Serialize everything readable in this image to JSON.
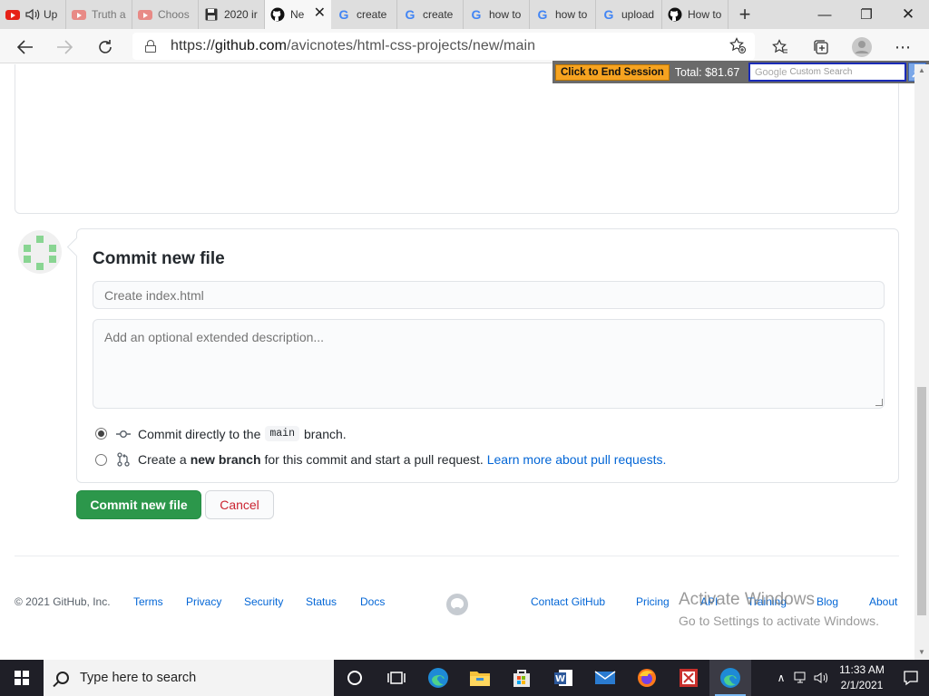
{
  "browser": {
    "tabs": [
      {
        "title": "Up",
        "icon": "youtube-icon",
        "audio": true
      },
      {
        "title": "Truth a",
        "icon": "youtube-icon"
      },
      {
        "title": "Choos",
        "icon": "youtube-icon"
      },
      {
        "title": "2020 ir",
        "icon": "floppy-icon"
      },
      {
        "title": "Ne",
        "icon": "github-icon",
        "active": true
      },
      {
        "title": "create",
        "icon": "google-icon"
      },
      {
        "title": "create",
        "icon": "google-icon"
      },
      {
        "title": "how to",
        "icon": "google-icon"
      },
      {
        "title": "how to",
        "icon": "google-icon"
      },
      {
        "title": "upload",
        "icon": "google-icon"
      },
      {
        "title": "How to",
        "icon": "github-icon"
      }
    ],
    "new_tab_glyph": "+",
    "window": {
      "minimize": "—",
      "restore": "❐",
      "close": "✕"
    },
    "url": {
      "scheme": "https://",
      "host": "github.com",
      "path": "/avicnotes/html-css-projects/new/main"
    },
    "session": {
      "end_label": "Click to End Session",
      "total": "Total: $81.67",
      "search_brand": "Google",
      "search_placeholder": "Custom Search"
    }
  },
  "commit": {
    "title": "Commit new file",
    "summary_placeholder": "Create index.html",
    "description_placeholder": "Add an optional extended description...",
    "option_direct": {
      "prefix": "Commit directly to the",
      "branch": "main",
      "suffix": "branch."
    },
    "option_new": {
      "prefix": "Create a",
      "bold": "new branch",
      "middle": "for this commit and start a pull request.",
      "link": "Learn more about pull requests."
    },
    "commit_button": "Commit new file",
    "cancel_button": "Cancel"
  },
  "footer": {
    "copyright": "© 2021 GitHub, Inc.",
    "links": [
      "Terms",
      "Privacy",
      "Security",
      "Status",
      "Docs",
      "Contact GitHub",
      "Pricing",
      "API",
      "Training",
      "Blog",
      "About"
    ]
  },
  "watermark": {
    "line1": "Activate Windows",
    "line2": "Go to Settings to activate Windows."
  },
  "taskbar": {
    "search_placeholder": "Type here to search",
    "time": "11:33 AM",
    "date": "2/1/2021"
  },
  "colors": {
    "primary_green": "#2c974b",
    "link_blue": "#0366d6",
    "danger_red": "#cb2431",
    "end_session_orange": "#f6a320"
  }
}
